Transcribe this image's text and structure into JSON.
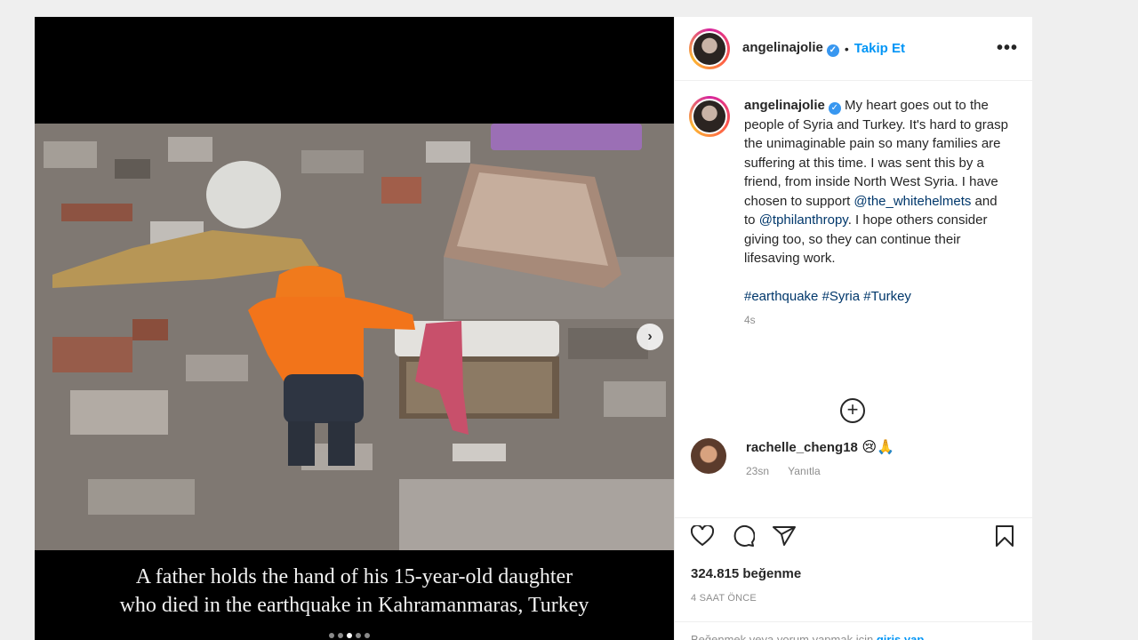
{
  "post": {
    "username": "angelinajolie",
    "separator": "•",
    "follow_label": "Takip Et",
    "more_label": "•••",
    "media": {
      "caption_line1": "A father holds the hand of his 15-year-old daughter",
      "caption_line2": "who died in the earthquake in Kahramanmaras, Turkey",
      "next_label": "›",
      "slide_count": 5,
      "active_slide": 2
    },
    "caption": {
      "user": "angelinajolie",
      "text1": " My heart goes out to the people of Syria and Turkey. It's hard to grasp the unimaginable pain so many families are suffering at this time. I was sent this by a friend, from inside North West Syria. I have chosen to support ",
      "mention1": "@the_whitehelmets",
      "text2": " and to ",
      "mention2": "@tphilanthropy",
      "text3": ". I hope others consider giving too, so they can continue their lifesaving work.",
      "hashtag1": "#earthquake",
      "hashtag2": "#Syria",
      "hashtag3": "#Turkey",
      "time": "4s"
    },
    "load_more_label": "+",
    "comment": {
      "user": "rachelle_cheng18",
      "emoji": "😢🙏",
      "time": "23sn",
      "reply_label": "Yanıtla"
    },
    "likes": "324.815 beğenme",
    "time_ago": "4 SAAT ÖNCE",
    "login_prompt": "Beğenmek veya yorum yapmak için",
    "login_link": "giriş yap"
  },
  "colors": {
    "accent": "#0095f6",
    "verified": "#3897f0",
    "text": "#262626",
    "muted": "#8e8e8e"
  },
  "icons": [
    "verified-badge-icon",
    "more-options-icon",
    "next-arrow-icon",
    "add-circle-icon",
    "heart-icon",
    "comment-icon",
    "share-icon",
    "bookmark-icon"
  ]
}
